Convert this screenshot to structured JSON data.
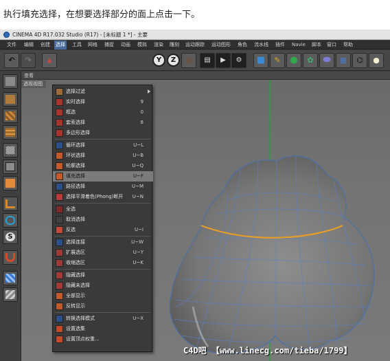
{
  "caption": "执行填充选择，在想要选择部分的面上点击一下。",
  "window": {
    "title": "CINEMA 4D R17.032 Studio (R17) - [未标题 1 *] - 主要"
  },
  "menubar": {
    "items": [
      "文件",
      "编辑",
      "创建",
      "选择",
      "工具",
      "网格",
      "捕捉",
      "动画",
      "模拟",
      "渲染",
      "雕刻",
      "运动跟踪",
      "运动图形",
      "角色",
      "流水线",
      "插件",
      "Navie",
      "脚本",
      "窗口",
      "帮助"
    ],
    "active": "选择"
  },
  "toolbar": {
    "axis_labels": [
      "Y",
      "Z"
    ]
  },
  "viewport": {
    "tab": "透视视图",
    "header_label": "查看"
  },
  "dropdown": {
    "items": [
      {
        "label": "选择过滤",
        "shortcut": "",
        "submenu": true,
        "color": "#9c6b3a"
      },
      {
        "label": "实时选择",
        "shortcut": "9",
        "color": "#a8322c"
      },
      {
        "label": "框选",
        "shortcut": "0",
        "color": "#a8322c"
      },
      {
        "label": "套索选择",
        "shortcut": "8",
        "color": "#a8322c"
      },
      {
        "label": "多边形选择",
        "shortcut": "",
        "color": "#a8322c"
      },
      {
        "label": "循环选择",
        "shortcut": "U~L",
        "color": "#2d4f8a"
      },
      {
        "label": "环状选择",
        "shortcut": "U~B",
        "color": "#c45a2a"
      },
      {
        "label": "轮廓选择",
        "shortcut": "U~Q",
        "color": "#c45a2a"
      },
      {
        "label": "填充选择",
        "shortcut": "U~F",
        "color": "#c45a2a",
        "highlight": true
      },
      {
        "label": "路径选择",
        "shortcut": "U~M",
        "color": "#2d4f8a"
      },
      {
        "label": "选择平滑着色(Phong)断开",
        "shortcut": "U~N",
        "color": "#b83a3a"
      },
      {
        "label": "全选",
        "shortcut": "",
        "color": "#7c2a2a"
      },
      {
        "label": "取消选择",
        "shortcut": "",
        "color": "#404040"
      },
      {
        "label": "反选",
        "shortcut": "U~I",
        "color": "#c24a3a"
      },
      {
        "label": "选择连接",
        "shortcut": "U~W",
        "color": "#2d4f8a"
      },
      {
        "label": "扩展选区",
        "shortcut": "U~Y",
        "color": "#9c3a3a"
      },
      {
        "label": "收缩选区",
        "shortcut": "U~K",
        "color": "#9c3a3a"
      },
      {
        "label": "隐藏选择",
        "shortcut": "",
        "color": "#a33a3a"
      },
      {
        "label": "隐藏未选择",
        "shortcut": "",
        "color": "#a33a3a"
      },
      {
        "label": "全部显示",
        "shortcut": "",
        "color": "#c05a2a"
      },
      {
        "label": "反转显示",
        "shortcut": "",
        "color": "#c05a2a"
      },
      {
        "label": "转换选择模式",
        "shortcut": "U~X",
        "color": "#2d4f8a"
      },
      {
        "label": "设置选集",
        "shortcut": "",
        "color": "#c44a2a"
      },
      {
        "label": "设置顶点权重...",
        "shortcut": "",
        "color": "#c44a2a"
      }
    ]
  },
  "watermark": "C4D吧 【www.linecg.com/tieba/1799】"
}
